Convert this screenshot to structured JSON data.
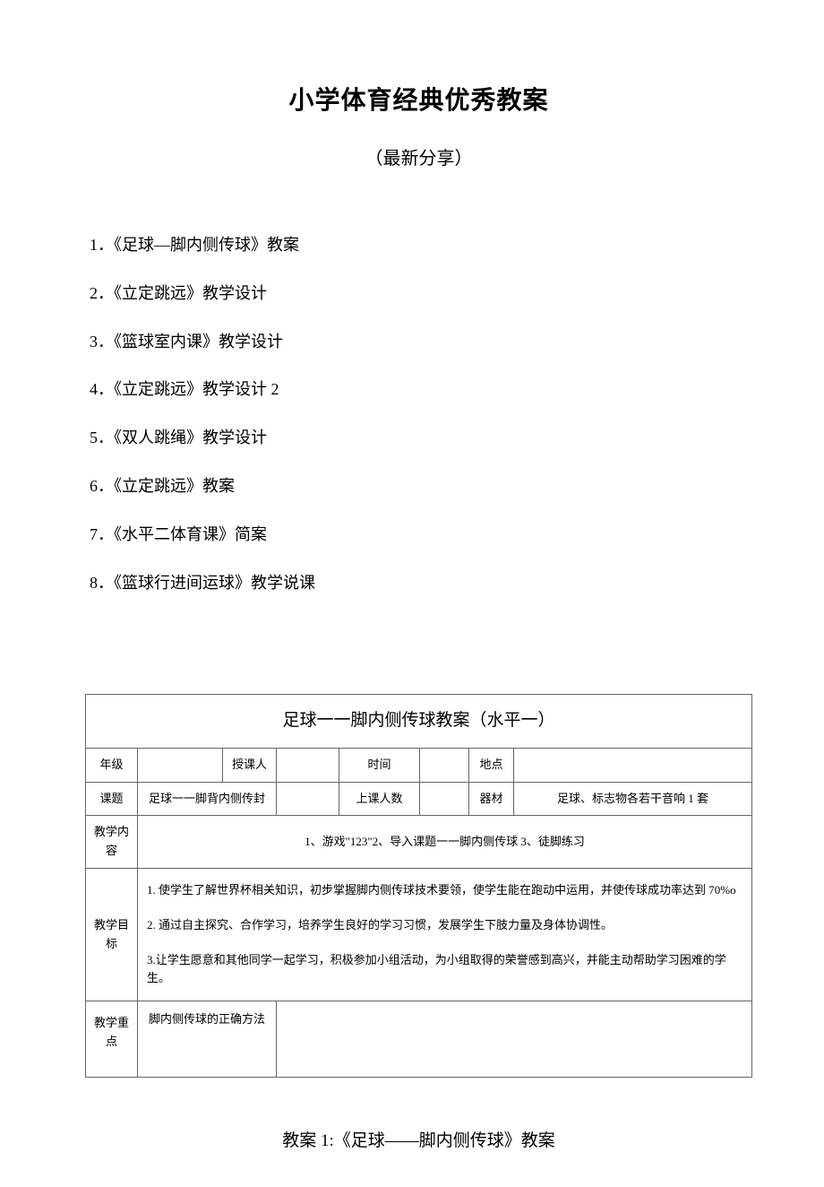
{
  "main_title": "小学体育经典优秀教案",
  "subtitle": "（最新分享）",
  "toc": [
    {
      "num": "1",
      "text": "．《足球—脚内侧传球》教案"
    },
    {
      "num": "2",
      "text": "．《立定跳远》教学设计"
    },
    {
      "num": "3",
      "text": "．《篮球室内课》教学设计"
    },
    {
      "num": "4",
      "text": "．《立定跳远》教学设计 2"
    },
    {
      "num": "5",
      "text": "．《双人跳绳》教学设计"
    },
    {
      "num": "6",
      "text": "．《立定跳远》教案"
    },
    {
      "num": "7",
      "text": "．《水平二体育课》简案"
    },
    {
      "num": "8",
      "text": "．《篮球行进间运球》教学说课"
    }
  ],
  "table": {
    "title": "足球一一脚内侧传球教案（水平一）",
    "row1": {
      "grade_label": "年级",
      "grade_val": "",
      "teacher_label": "授课人",
      "teacher_val": "",
      "time_label": "时间",
      "time_val": "",
      "place_label": "地点",
      "place_val": ""
    },
    "row2": {
      "topic_label": "课题",
      "topic_val": "足球一一脚背内侧传封",
      "count_label": "上课人数",
      "count_val": "",
      "equip_label": "器材",
      "equip_val": "足球、标志物各若干音响 1 套"
    },
    "row3": {
      "content_label": "教学内容",
      "content_val": "1、游戏\"123\"2、导入课题一一脚内侧传球 3、徒脚练习"
    },
    "row4": {
      "goals_label": "教学目标",
      "g1": "1. 使学生了解世界杯相关知识，初步掌握脚内侧传球技术要领，使学生能在跑动中运用，并使传球成功率达到 70%o",
      "g2": "2. 通过自主探究、合作学习，培养学生良好的学习习惯，发展学生下肢力量及身体协调性。",
      "g3": "3.让学生愿意和其他同学一起学习，积极参加小组活动，为小组取得的荣誉感到高兴，并能主动帮助学习困难的学生。"
    },
    "row5": {
      "focus_label": "教学重点",
      "focus_val": "脚内侧传球的正确方法"
    }
  },
  "footer_title": "教案 1:《足球——脚内侧传球》教案"
}
